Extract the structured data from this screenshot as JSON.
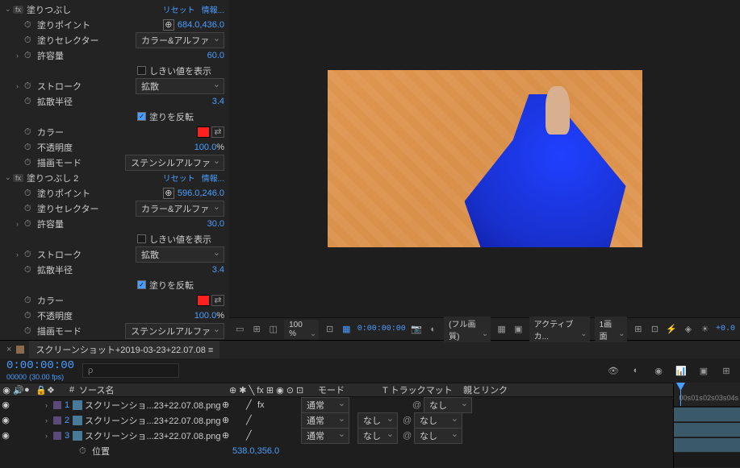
{
  "effects": [
    {
      "name": "塗りつぶし",
      "reset": "リセット",
      "info": "情報...",
      "props": [
        {
          "label": "塗りポイント",
          "type": "point",
          "value": "684.0,436.0"
        },
        {
          "label": "塗りセレクター",
          "type": "dropdown",
          "value": "カラー&アルファ"
        },
        {
          "label": "許容量",
          "type": "num",
          "value": "60.0",
          "expand": true
        },
        {
          "label": "",
          "type": "check",
          "value": "しきい値を表示",
          "checked": false
        },
        {
          "label": "ストローク",
          "type": "dropdown",
          "value": "拡散",
          "expand": true
        },
        {
          "label": "拡散半径",
          "type": "num",
          "value": "3.4"
        },
        {
          "label": "",
          "type": "check",
          "value": "塗りを反転",
          "checked": true
        },
        {
          "label": "カラー",
          "type": "color",
          "value": "#ff2020"
        },
        {
          "label": "不透明度",
          "type": "pct",
          "value": "100.0"
        },
        {
          "label": "描画モード",
          "type": "dropdown",
          "value": "ステンシルアルファ"
        }
      ]
    },
    {
      "name": "塗りつぶし 2",
      "reset": "リセット",
      "info": "情報...",
      "props": [
        {
          "label": "塗りポイント",
          "type": "point",
          "value": "596.0,246.0"
        },
        {
          "label": "塗りセレクター",
          "type": "dropdown",
          "value": "カラー&アルファ"
        },
        {
          "label": "許容量",
          "type": "num",
          "value": "30.0",
          "expand": true
        },
        {
          "label": "",
          "type": "check",
          "value": "しきい値を表示",
          "checked": false
        },
        {
          "label": "ストローク",
          "type": "dropdown",
          "value": "拡散",
          "expand": true
        },
        {
          "label": "拡散半径",
          "type": "num",
          "value": "3.4"
        },
        {
          "label": "",
          "type": "check",
          "value": "塗りを反転",
          "checked": true
        },
        {
          "label": "カラー",
          "type": "color",
          "value": "#ff2020"
        },
        {
          "label": "不透明度",
          "type": "pct",
          "value": "100.0"
        },
        {
          "label": "描画モード",
          "type": "dropdown",
          "value": "ステンシルアルファ"
        }
      ]
    }
  ],
  "preview_toolbar": {
    "zoom": "100 %",
    "timecode": "0:00:00:00",
    "quality": "(フル画質)",
    "camera": "アクティブカ...",
    "views": "1画面",
    "offset": "+0.0"
  },
  "timeline": {
    "comp_name": "スクリーンショット+2019-03-23+22.07.08",
    "current_tc": "0:00:00:00",
    "frame": "00000",
    "fps": "(30.00 fps)",
    "search_placeholder": "ρ",
    "columns": {
      "source": "ソース名",
      "mode": "モード",
      "trkmat": "T  トラックマット",
      "parent": "親とリンク"
    },
    "mode_normal": "通常",
    "none": "なし",
    "layers": [
      {
        "num": "1",
        "name": "スクリーンショ...23+22.07.08.png",
        "fx": true
      },
      {
        "num": "2",
        "name": "スクリーンショ...23+22.07.08.png",
        "fx": false
      },
      {
        "num": "3",
        "name": "スクリーンショ...23+22.07.08.png",
        "fx": false
      }
    ],
    "position_label": "位置",
    "position_value": "538.0,356.0",
    "ruler": [
      "00s",
      "01s",
      "02s",
      "03s",
      "04s"
    ]
  }
}
